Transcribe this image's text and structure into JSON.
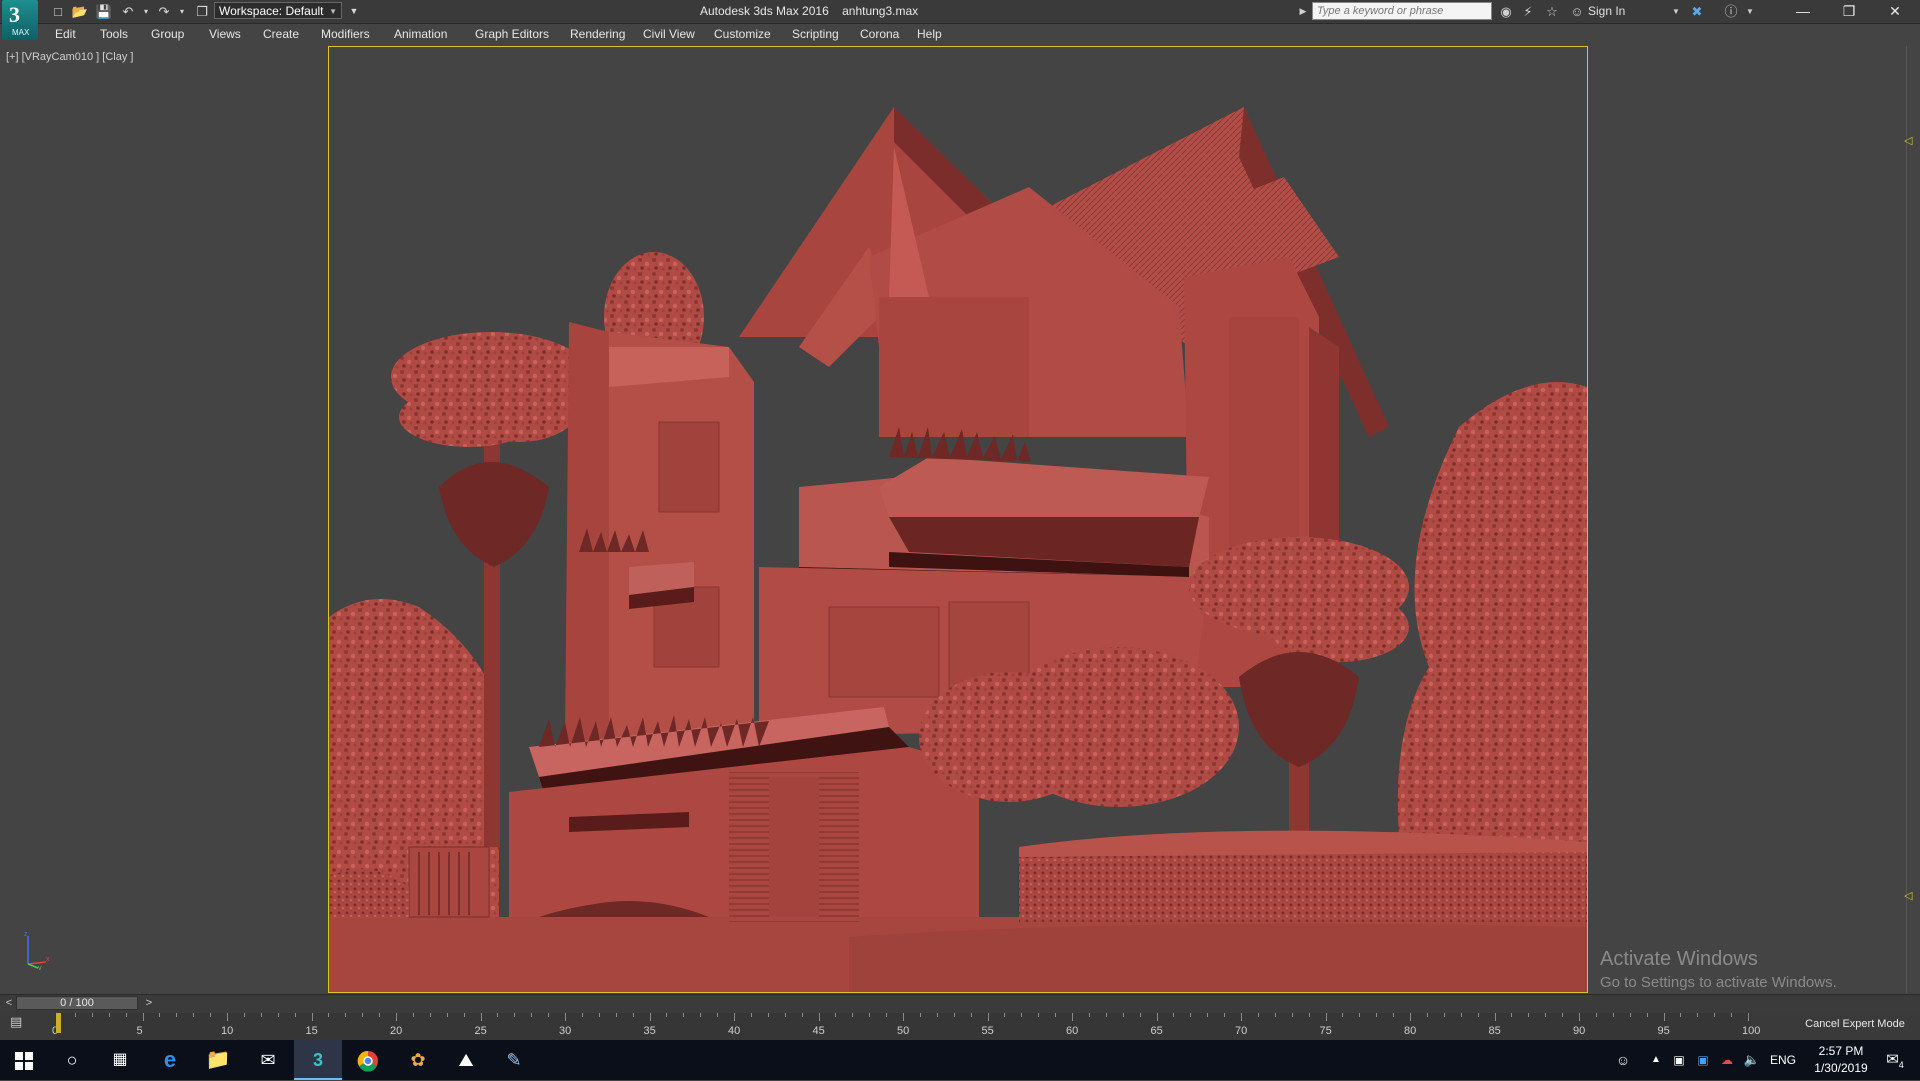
{
  "titlebar": {
    "app_logo_text": "MAX",
    "workspace_label": "Workspace: Default",
    "app_title": "Autodesk 3ds Max 2016",
    "file_name": "anhtung3.max",
    "search_placeholder": "Type a keyword or phrase",
    "sign_in_label": "Sign In"
  },
  "menu": {
    "items": [
      "Edit",
      "Tools",
      "Group",
      "Views",
      "Create",
      "Modifiers",
      "Animation",
      "Graph Editors",
      "Rendering",
      "Civil View",
      "Customize",
      "Scripting",
      "Corona",
      "Help"
    ]
  },
  "viewport": {
    "label": "[+] [VRayCam010 ] [Clay ]",
    "border_color": "#d6c52a",
    "scene_color": "#b14b45"
  },
  "watermark": {
    "line1": "Activate Windows",
    "line2": "Go to Settings to activate Windows."
  },
  "time_slider": {
    "frame_display": "0 / 100",
    "prev_label": "<",
    "next_label": ">"
  },
  "trackbar": {
    "tick_labels": [
      "0",
      "5",
      "10",
      "15",
      "20",
      "25",
      "30",
      "35",
      "40",
      "45",
      "50",
      "55",
      "60",
      "65",
      "70",
      "75",
      "80",
      "85",
      "90",
      "95",
      "100"
    ],
    "cancel_expert_label": "Cancel Expert Mode"
  },
  "taskbar": {
    "language": "ENG",
    "time": "2:57 PM",
    "date": "1/30/2019",
    "notification_count": "4"
  }
}
